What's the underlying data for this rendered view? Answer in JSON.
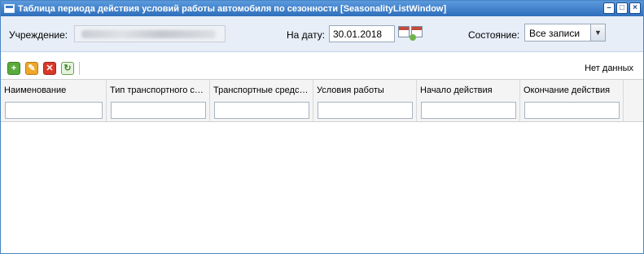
{
  "window": {
    "title": "Таблица периода действия условий работы автомобиля по сезонности [SeasonalityListWindow]",
    "buttons": [
      "minimize",
      "maximize",
      "close"
    ]
  },
  "filters": {
    "institution_label": "Учреждение:",
    "date_label": "На дату:",
    "date_value": "30.01.2018",
    "state_label": "Состояние:",
    "state_value": "Все записи"
  },
  "toolbar": {
    "icons": [
      "add-icon",
      "edit-icon",
      "delete-icon",
      "refresh-icon"
    ],
    "no_data_text": "Нет данных"
  },
  "grid": {
    "columns": [
      "Наименование",
      "Тип транспортного средства",
      "Транспортные средства",
      "Условия работы",
      "Начало действия",
      "Окончание действия"
    ]
  }
}
